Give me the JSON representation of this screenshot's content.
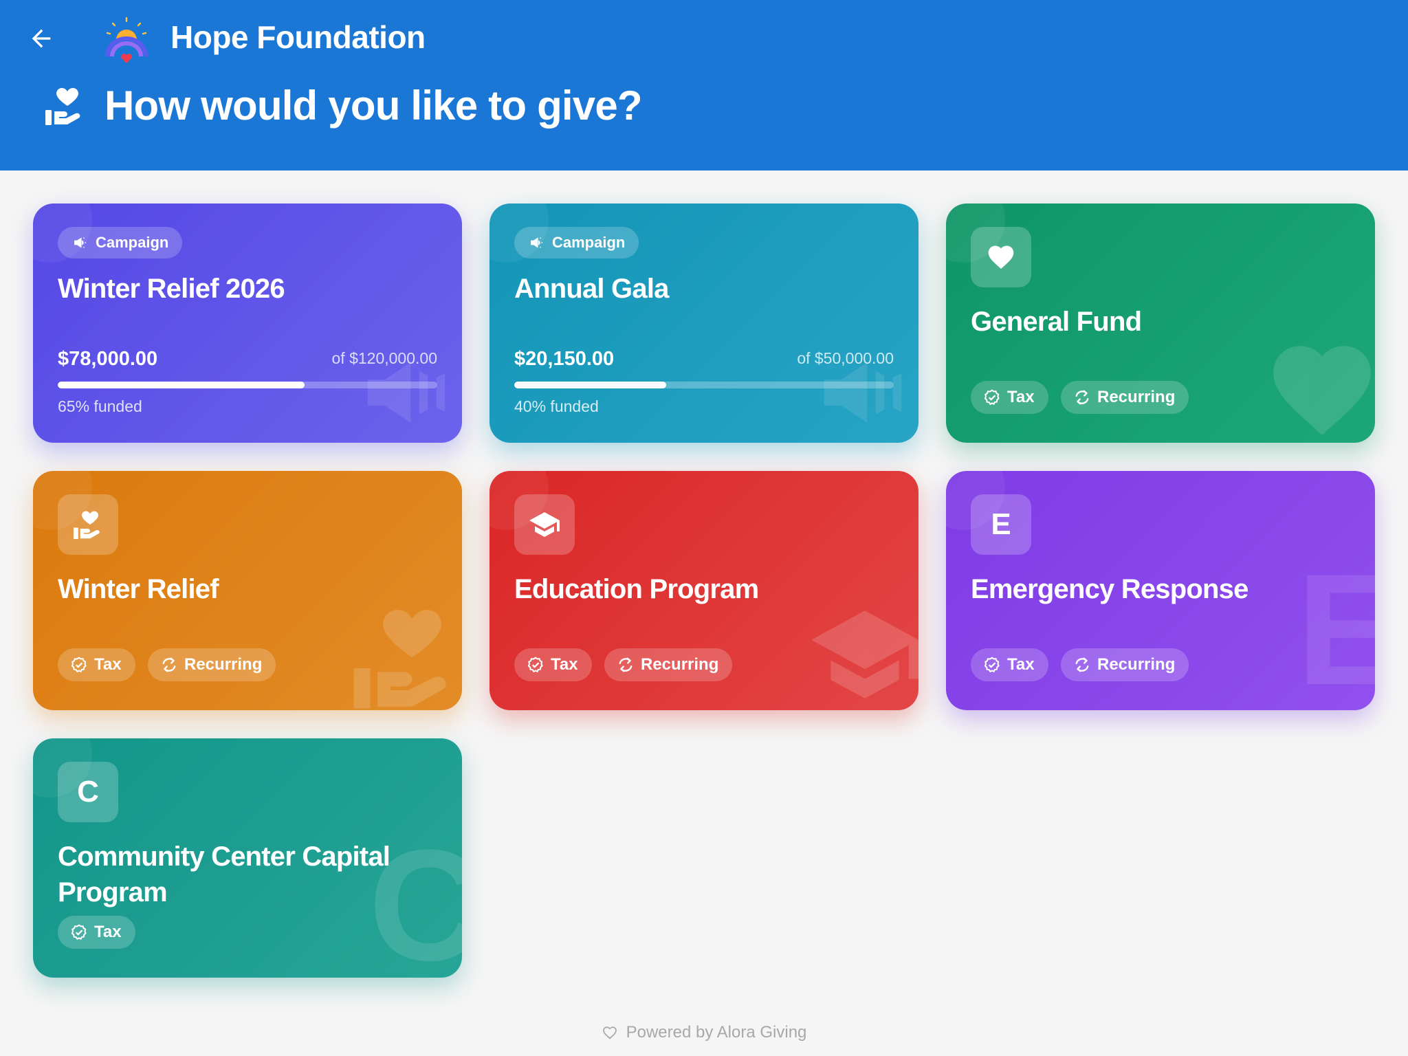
{
  "header": {
    "org_name": "Hope Foundation",
    "title": "How would you like to give?",
    "background": "#1b77d6"
  },
  "icons": {
    "back": "arrow-left-icon",
    "logo": "rainbow-sun-heart-logo",
    "give": "hand-holding-heart-icon",
    "campaign": "megaphone-icon",
    "tax": "badge-check-icon",
    "recurring": "refresh-icon",
    "general_fund": "heart-icon",
    "education": "graduation-cap-icon"
  },
  "campaigns": [
    {
      "badge": "Campaign",
      "title": "Winter Relief 2026",
      "raised": "$78,000.00",
      "goal": "of $120,000.00",
      "progress": 0.65,
      "funded_text": "65% funded",
      "color": "#5548e6"
    },
    {
      "badge": "Campaign",
      "title": "Annual Gala",
      "raised": "$20,150.00",
      "goal": "of $50,000.00",
      "progress": 0.4,
      "funded_text": "40% funded",
      "color": "#1395b7"
    }
  ],
  "funds": [
    {
      "title": "General Fund",
      "icon": "heart-icon",
      "tax": "Tax",
      "recurring": "Recurring",
      "color": "#0f9668"
    },
    {
      "title": "Winter Relief",
      "icon": "hand-holding-heart-icon",
      "tax": "Tax",
      "recurring": "Recurring",
      "color": "#db7a0d"
    },
    {
      "title": "Education Program",
      "icon": "graduation-cap-icon",
      "tax": "Tax",
      "recurring": "Recurring",
      "color": "#db2626"
    },
    {
      "title": "Emergency Response",
      "letter": "E",
      "tax": "Tax",
      "recurring": "Recurring",
      "color": "#7f3be6"
    },
    {
      "title": "Community Center Capital Program",
      "letter": "C",
      "tax": "Tax",
      "color": "#13968a"
    }
  ],
  "footer": {
    "text": "Powered by Alora Giving"
  }
}
